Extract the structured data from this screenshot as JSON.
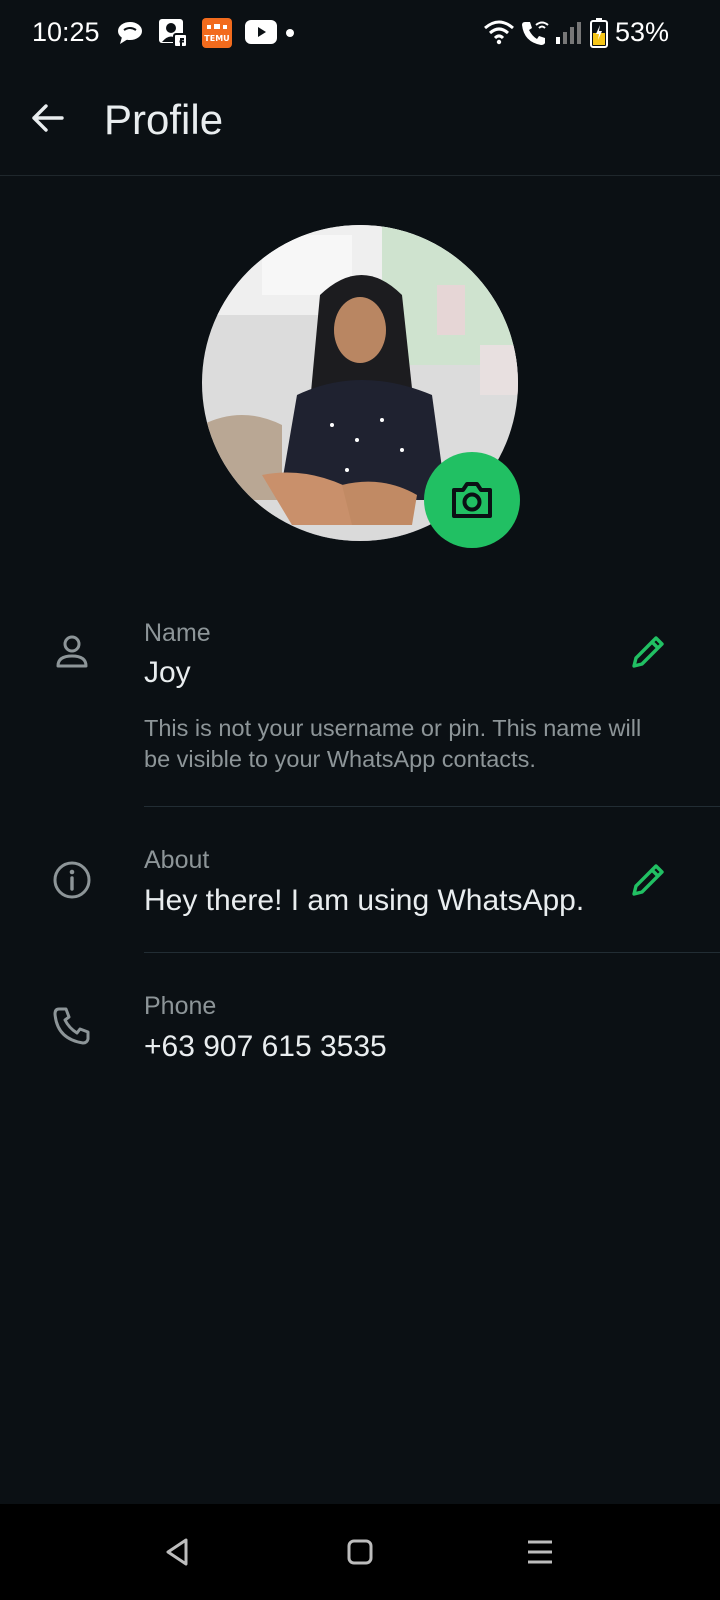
{
  "status_bar": {
    "time": "10:25",
    "notification_icons": [
      "chat-bubble-icon",
      "facebook-contacts-icon",
      "temu-app-icon",
      "youtube-icon",
      "more-dot-icon"
    ],
    "system_icons": [
      "wifi-icon",
      "wifi-calling-icon",
      "signal-icon",
      "battery-icon"
    ],
    "battery": "53%"
  },
  "app_bar": {
    "title": "Profile",
    "back_icon": "arrow-back-icon"
  },
  "profile": {
    "photo_description": "profile photo",
    "camera_icon": "camera-icon",
    "camera_button_color": "#21c063"
  },
  "fields": {
    "name": {
      "label": "Name",
      "value": "Joy",
      "hint": "This is not your username or pin. This name will be visible to your WhatsApp contacts.",
      "icon": "person-icon",
      "edit_icon": "pencil-icon"
    },
    "about": {
      "label": "About",
      "value": "Hey there! I am using WhatsApp.",
      "icon": "info-icon",
      "edit_icon": "pencil-icon"
    },
    "phone": {
      "label": "Phone",
      "value": "+63 907 615 3535",
      "icon": "phone-icon"
    }
  },
  "colors": {
    "background": "#0b1014",
    "accent": "#21c063",
    "primary_text": "#e9edef",
    "secondary_text": "#8d9598"
  },
  "nav_bar": {
    "buttons": [
      "back-triangle-icon",
      "home-square-icon",
      "recents-menu-icon"
    ]
  }
}
